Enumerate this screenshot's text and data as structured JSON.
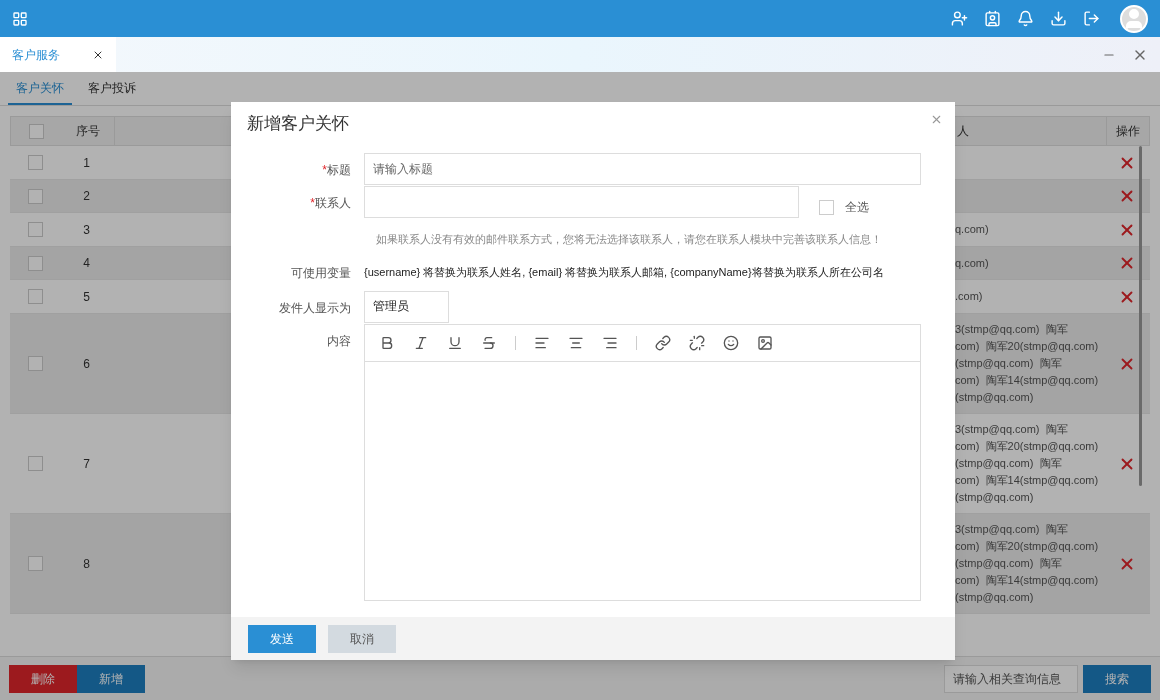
{
  "window_tabs": [
    {
      "label": "客户服务",
      "selected": true
    }
  ],
  "subtabs": [
    {
      "label": "客户关怀",
      "selected": true
    },
    {
      "label": "客户投诉",
      "selected": false
    }
  ],
  "table": {
    "all_checked": false,
    "columns": [
      "序号",
      "人",
      "操作"
    ],
    "rows": [
      {
        "number": "1",
        "checked": false,
        "contact": []
      },
      {
        "number": "2",
        "checked": false,
        "contact": []
      },
      {
        "number": "3",
        "checked": false,
        "contact": [
          "q.com)"
        ]
      },
      {
        "number": "4",
        "checked": false,
        "contact": [
          "q.com)"
        ]
      },
      {
        "number": "5",
        "checked": false,
        "contact": [
          ".com)"
        ]
      },
      {
        "number": "6",
        "checked": false,
        "contact": [
          "3(stmp@qq.com)  陶军",
          "com)  陶军20(stmp@qq.com)",
          "(stmp@qq.com)  陶军",
          "com)  陶军14(stmp@qq.com)",
          "(stmp@qq.com)"
        ]
      },
      {
        "number": "7",
        "checked": false,
        "contact": [
          "3(stmp@qq.com)  陶军",
          "com)  陶军20(stmp@qq.com)",
          "(stmp@qq.com)  陶军",
          "com)  陶军14(stmp@qq.com)",
          "(stmp@qq.com)"
        ]
      },
      {
        "number": "8",
        "checked": false,
        "contact": [
          "3(stmp@qq.com)  陶军",
          "com)  陶军20(stmp@qq.com)",
          "(stmp@qq.com)  陶军",
          "com)  陶军14(stmp@qq.com)",
          "(stmp@qq.com)"
        ]
      }
    ]
  },
  "actions": [
    {
      "label": "删除",
      "kind": "danger"
    },
    {
      "label": "新增",
      "kind": "primary"
    }
  ],
  "search": {
    "placeholder": "请输入相关查询信息",
    "button": "搜索"
  },
  "dialog": {
    "title": "新增客户关怀",
    "title_field": {
      "mark": "*",
      "label": "标题",
      "placeholder": "请输入标题"
    },
    "contact_field": {
      "mark": "*",
      "label": "联系人",
      "select_all": {
        "label": "全选",
        "checked": false
      }
    },
    "hint": "如果联系人没有有效的邮件联系方式，您将无法选择该联系人，请您在联系人模块中完善该联系人信息！",
    "variables": {
      "label": "可使用变量",
      "text": "{username} 将替换为联系人姓名, {email} 将替换为联系人邮箱, {companyName}将替换为联系人所在公司名"
    },
    "sender": {
      "label": "发件人显示为",
      "value": "管理员"
    },
    "content": {
      "label": "内容"
    },
    "buttons": [
      {
        "label": "发送",
        "kind": "primary"
      },
      {
        "label": "取消",
        "kind": "secondary"
      }
    ]
  }
}
